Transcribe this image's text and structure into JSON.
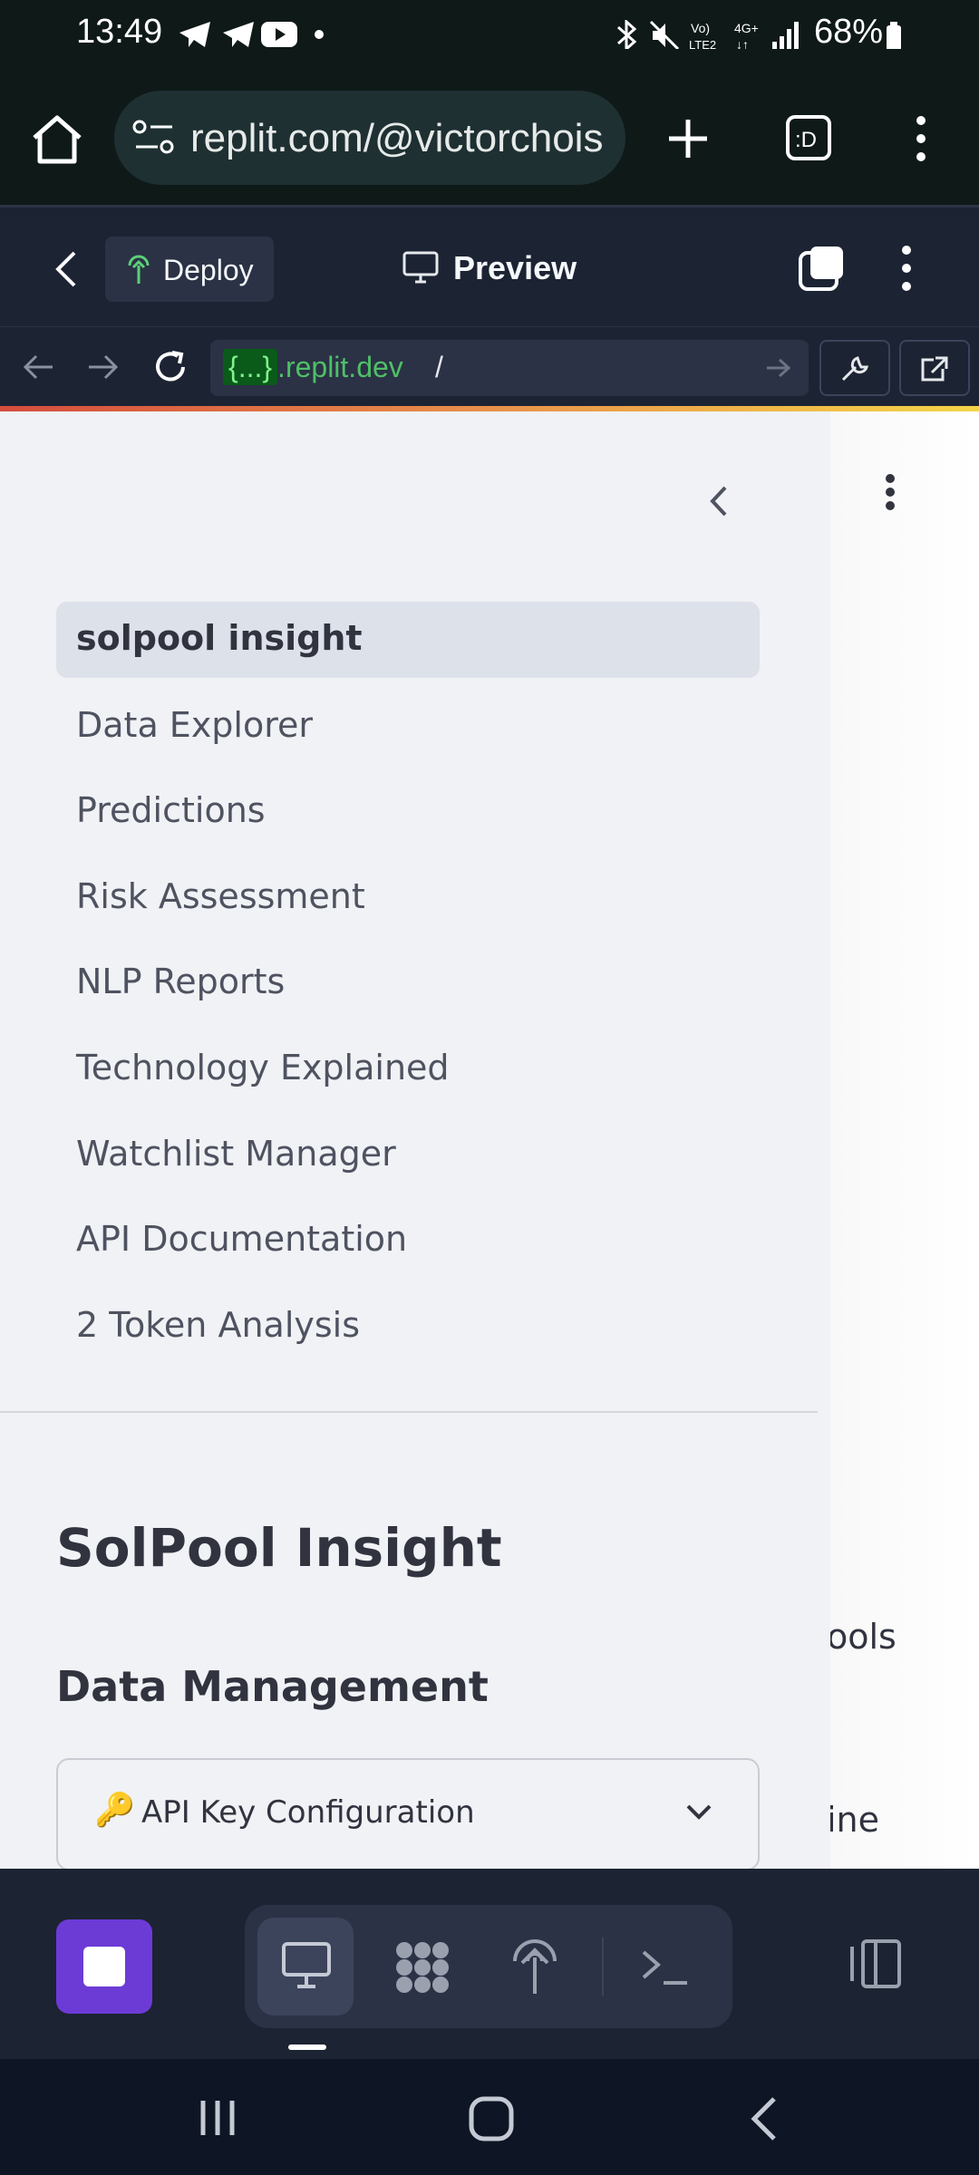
{
  "status_bar": {
    "time": "13:49",
    "battery": "68%"
  },
  "browser": {
    "url": "replit.com/@victorchois"
  },
  "replit_header": {
    "deploy_label": "Deploy",
    "preview_label": "Preview"
  },
  "webview": {
    "host_braces": "{...}",
    "host_suffix": ".replit.dev",
    "path": "/"
  },
  "sidebar": {
    "nav_items": [
      "solpool insight",
      "Data Explorer",
      "Predictions",
      "Risk Assessment",
      "NLP Reports",
      "Technology Explained",
      "Watchlist Manager",
      "API Documentation",
      "2 Token Analysis"
    ],
    "app_title": "SolPool Insight",
    "section_title": "Data Management",
    "expander_label": "API Key Configuration",
    "expander_icon": "🔑"
  },
  "main": {
    "clipped_text_1": "ools",
    "clipped_text_2": "ine"
  },
  "colors": {
    "accent_purple": "#6c3bd6",
    "replit_green": "#4ec067",
    "sidebar_bg": "#f0f2f6"
  }
}
